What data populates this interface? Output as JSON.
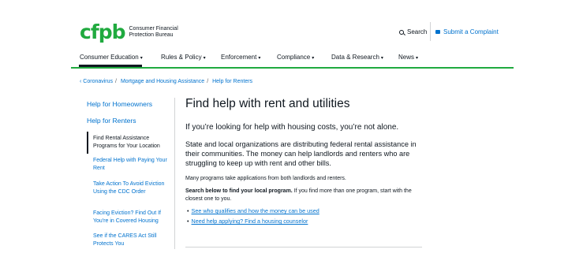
{
  "header": {
    "logo_mark": "cfpb",
    "logo_text_line1": "Consumer Financial",
    "logo_text_line2": "Protection Bureau",
    "search_label": "Search",
    "complaint_label": "Submit a Complaint"
  },
  "nav": {
    "items": [
      {
        "label": "Consumer Education"
      },
      {
        "label": "Rules & Policy"
      },
      {
        "label": "Enforcement"
      },
      {
        "label": "Compliance"
      },
      {
        "label": "Data & Research"
      },
      {
        "label": "News"
      }
    ],
    "active": "Consumer Education"
  },
  "breadcrumb": {
    "items": [
      "Coronavirus",
      "Mortgage and Housing Assistance",
      "Help for Renters"
    ]
  },
  "sidebar": {
    "top_items": [
      "Help for Homeowners",
      "Help for Renters"
    ],
    "sub_items": [
      "Find Rental Assistance Programs for Your Location",
      "Federal Help with Paying Your Rent",
      "Take Action To Avoid Eviction Using the CDC Order",
      "Facing Eviction? Find Out If You're in Covered Housing",
      "See if the CARES Act Still Protects You"
    ],
    "current": "Find Rental Assistance Programs for Your Location"
  },
  "main": {
    "title": "Find help with rent and utilities",
    "lead": "If you’re looking for help with housing costs, you’re not alone.",
    "paragraph": "State and local organizations are distributing federal rental assistance in their communities. The money can help landlords and renters who are struggling to keep up with rent and other bills.",
    "note": "Many programs take applications from both landlords and renters.",
    "search_instruction_bold": "Search below to find your local program.",
    "search_instruction_rest": " If you find more than one program, start with the closest one to you.",
    "links": [
      "See who qualifies and how the money can be used",
      "Need help applying? Find a housing counselor"
    ]
  },
  "colors": {
    "brand_green": "#20aa3f",
    "link_blue": "#0072ce",
    "text": "#101820"
  }
}
